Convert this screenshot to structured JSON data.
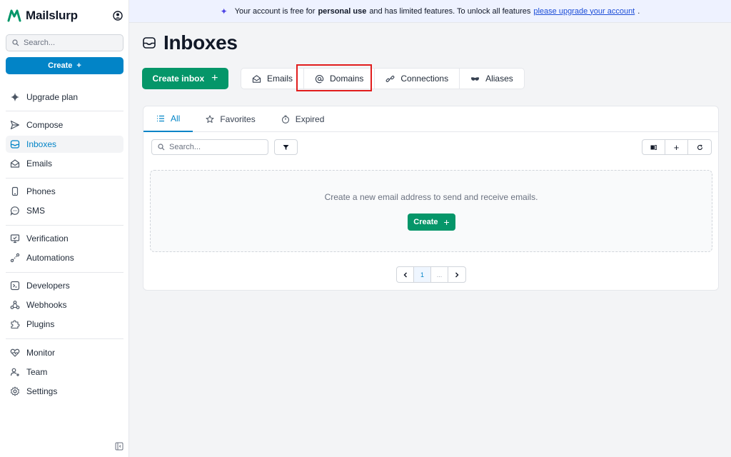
{
  "brand": {
    "name": "Mailslurp",
    "logo_color": "#059669"
  },
  "sidebar": {
    "search_placeholder": "Search...",
    "create_label": "Create",
    "items": [
      {
        "label": "Upgrade plan",
        "icon": "sparkle-icon"
      },
      {
        "label": "Compose",
        "icon": "send-icon"
      },
      {
        "label": "Inboxes",
        "icon": "inbox-icon",
        "active": true
      },
      {
        "label": "Emails",
        "icon": "envelope-open-icon"
      },
      {
        "label": "Phones",
        "icon": "phone-icon"
      },
      {
        "label": "SMS",
        "icon": "chat-icon"
      },
      {
        "label": "Verification",
        "icon": "monitor-check-icon"
      },
      {
        "label": "Automations",
        "icon": "automation-icon"
      },
      {
        "label": "Developers",
        "icon": "terminal-icon"
      },
      {
        "label": "Webhooks",
        "icon": "webhook-icon"
      },
      {
        "label": "Plugins",
        "icon": "puzzle-icon"
      },
      {
        "label": "Monitor",
        "icon": "heartbeat-icon"
      },
      {
        "label": "Team",
        "icon": "users-icon"
      },
      {
        "label": "Settings",
        "icon": "gear-icon"
      }
    ]
  },
  "banner": {
    "prefix": "Your account is free for",
    "bold": "personal use",
    "middle": "and has limited features. To unlock all features",
    "link": "please upgrade your account",
    "suffix": "."
  },
  "page": {
    "title": "Inboxes",
    "create_inbox_label": "Create inbox",
    "segments": [
      {
        "label": "Emails",
        "icon": "envelope-open-icon"
      },
      {
        "label": "Domains",
        "icon": "at-icon"
      },
      {
        "label": "Connections",
        "icon": "link-icon"
      },
      {
        "label": "Aliases",
        "icon": "mask-icon"
      }
    ]
  },
  "card": {
    "tabs": [
      {
        "label": "All",
        "icon": "list-icon",
        "active": true
      },
      {
        "label": "Favorites",
        "icon": "star-icon"
      },
      {
        "label": "Expired",
        "icon": "timer-icon"
      }
    ],
    "search_placeholder": "Search...",
    "empty_text": "Create a new email address to send and receive emails.",
    "empty_create_label": "Create",
    "pagination": {
      "current": "1",
      "ellipsis": "..."
    }
  },
  "colors": {
    "accent": "#0284c7",
    "primary_green": "#059669",
    "highlight": "#e11d1d"
  }
}
